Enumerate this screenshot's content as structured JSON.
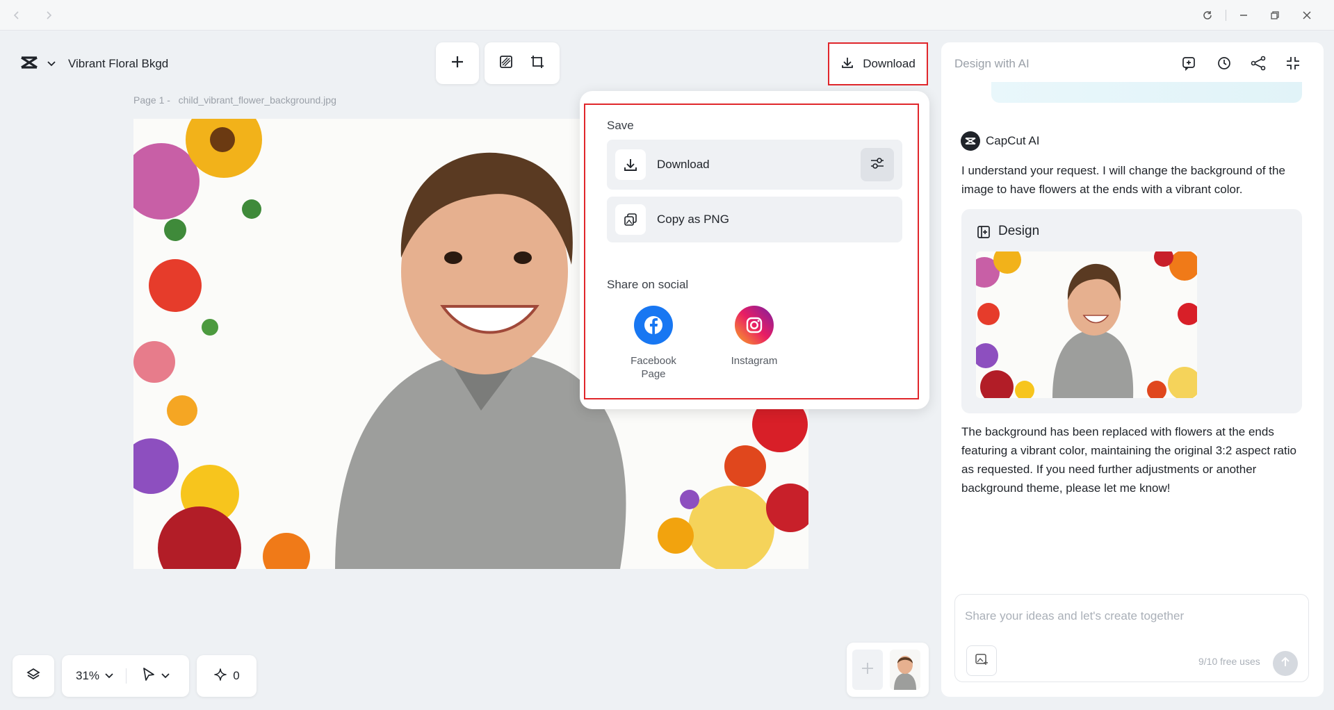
{
  "project": {
    "title": "Vibrant Floral Bkgd"
  },
  "canvas": {
    "page_prefix": "Page 1 -",
    "file_name": "child_vibrant_flower_background.jpg",
    "zoom": "31%",
    "ai_credits": "0"
  },
  "toolbar": {
    "download_label": "Download"
  },
  "download_menu": {
    "save_label": "Save",
    "download_label": "Download",
    "copy_label": "Copy as PNG",
    "share_label": "Share on social",
    "social": [
      {
        "label": "Facebook Page",
        "color": "#1877f2"
      },
      {
        "label": "Instagram",
        "color": "#d6249f"
      }
    ]
  },
  "ai_panel": {
    "title": "Design with AI",
    "assistant_name": "CapCut AI",
    "message_1": "I understand your request. I will change the background of the image to have flowers at the ends with a vibrant color.",
    "design_title": "Design",
    "message_2": "The background has been replaced with flowers at the ends featuring a vibrant color, maintaining the original 3:2 aspect ratio as requested. If you need further adjustments or another background theme, please let me know!",
    "input_placeholder": "Share your ideas and let's create together",
    "free_uses": "9/10 free uses"
  },
  "colors": {
    "highlight": "#e0262b",
    "panel_bg": "#eef1f4",
    "accent_text": "#1f2329"
  }
}
